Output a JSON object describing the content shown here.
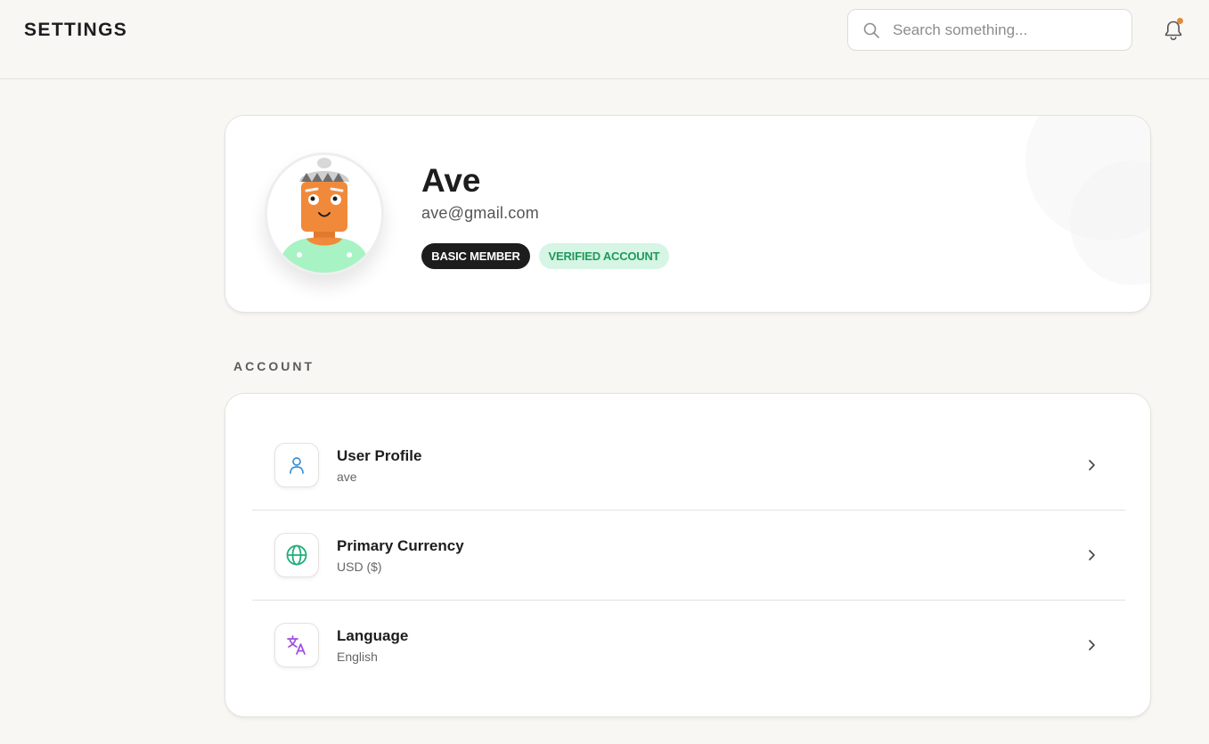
{
  "header": {
    "title": "SETTINGS",
    "search_placeholder": "Search something...",
    "notification_dot_color": "#e38a3c"
  },
  "profile": {
    "name": "Ave",
    "email": "ave@gmail.com",
    "badges": [
      {
        "label": "BASIC MEMBER",
        "color": "#1d1d1d"
      },
      {
        "label": "VERIFIED ACCOUNT",
        "color": "#1f9a5a"
      }
    ]
  },
  "account": {
    "section_label": "ACCOUNT",
    "rows": [
      {
        "icon": "user-icon",
        "title": "User Profile",
        "subtitle": "ave",
        "icon_color": "#3b8fd9"
      },
      {
        "icon": "globe-icon",
        "title": "Primary Currency",
        "subtitle": "USD ($)",
        "icon_color": "#1fae7a"
      },
      {
        "icon": "translate-icon",
        "title": "Language",
        "subtitle": "English",
        "icon_color": "#a04ee0"
      }
    ]
  }
}
